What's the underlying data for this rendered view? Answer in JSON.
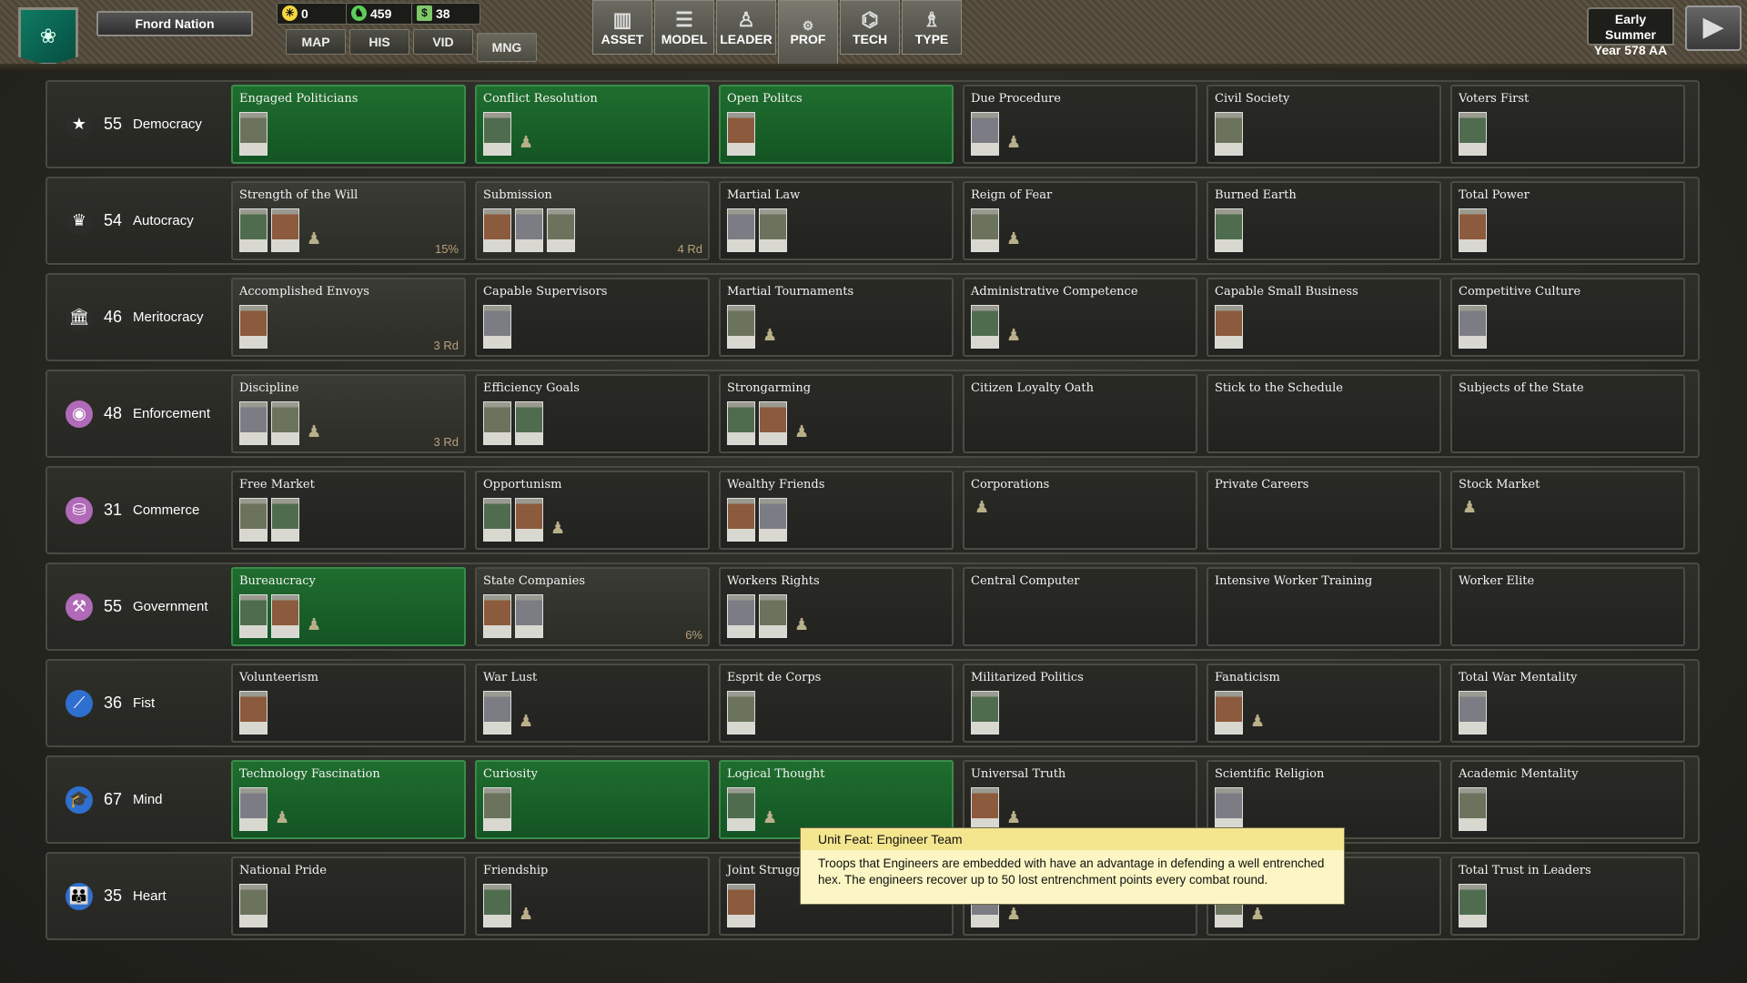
{
  "header": {
    "nation": "Fnord Nation",
    "resources": [
      {
        "icon": "sun-icon",
        "value": "0",
        "color": "#f5d63c"
      },
      {
        "icon": "shield-icon",
        "value": "459",
        "color": "#5ccf5a"
      },
      {
        "icon": "money-icon",
        "value": "38",
        "color": "#7ec86a"
      }
    ],
    "nav_tabs": [
      "MAP",
      "HIS",
      "VID",
      "MNG"
    ],
    "active_nav": "MNG",
    "modes": [
      {
        "label": "ASSET",
        "icon": "building-icon"
      },
      {
        "label": "MODEL",
        "icon": "sliders-icon"
      },
      {
        "label": "LEADER",
        "icon": "leader-icon"
      },
      {
        "label": "PROF",
        "icon": "gears-icon"
      },
      {
        "label": "TECH",
        "icon": "tech-tree-icon"
      },
      {
        "label": "TYPE",
        "icon": "soldier-icon"
      }
    ],
    "active_mode": "PROF",
    "season": "Early Summer",
    "year": "Year 578 AA"
  },
  "rows": [
    {
      "score": "55",
      "name": "Democracy",
      "icon": "star-icon",
      "icon_color": "#2c2c28",
      "cards": [
        {
          "title": "Engaged Politicians",
          "state": "done",
          "units": 1,
          "fig": false,
          "status": ""
        },
        {
          "title": "Conflict Resolution",
          "state": "done",
          "units": 1,
          "fig": true,
          "status": ""
        },
        {
          "title": "Open Politcs",
          "state": "done",
          "units": 1,
          "fig": false,
          "status": ""
        },
        {
          "title": "Due Procedure",
          "state": "locked",
          "units": 1,
          "fig": true,
          "status": ""
        },
        {
          "title": "Civil Society",
          "state": "locked",
          "units": 1,
          "fig": false,
          "status": ""
        },
        {
          "title": "Voters First",
          "state": "locked",
          "units": 1,
          "fig": false,
          "status": ""
        }
      ]
    },
    {
      "score": "54",
      "name": "Autocracy",
      "icon": "crown-icon",
      "icon_color": "#2c2c28",
      "cards": [
        {
          "title": "Strength of the Will",
          "state": "prog",
          "units": 2,
          "fig": true,
          "status": "15%"
        },
        {
          "title": "Submission",
          "state": "prog",
          "units": 3,
          "fig": false,
          "status": "4 Rd"
        },
        {
          "title": "Martial Law",
          "state": "locked",
          "units": 2,
          "fig": false,
          "status": ""
        },
        {
          "title": "Reign of Fear",
          "state": "locked",
          "units": 1,
          "fig": true,
          "status": ""
        },
        {
          "title": "Burned Earth",
          "state": "locked",
          "units": 1,
          "fig": false,
          "status": ""
        },
        {
          "title": "Total Power",
          "state": "locked",
          "units": 1,
          "fig": false,
          "status": ""
        }
      ]
    },
    {
      "score": "46",
      "name": "Meritocracy",
      "icon": "columns-icon",
      "icon_color": "#2c2c28",
      "cards": [
        {
          "title": "Accomplished Envoys",
          "state": "prog",
          "units": 1,
          "fig": false,
          "status": "3 Rd"
        },
        {
          "title": "Capable Supervisors",
          "state": "locked",
          "units": 1,
          "fig": false,
          "status": ""
        },
        {
          "title": "Martial Tournaments",
          "state": "locked",
          "units": 1,
          "fig": true,
          "status": ""
        },
        {
          "title": "Administrative Competence",
          "state": "locked",
          "units": 1,
          "fig": true,
          "status": ""
        },
        {
          "title": "Capable Small Business",
          "state": "locked",
          "units": 1,
          "fig": false,
          "status": ""
        },
        {
          "title": "Competitive Culture",
          "state": "locked",
          "units": 1,
          "fig": false,
          "status": ""
        }
      ]
    },
    {
      "score": "48",
      "name": "Enforcement",
      "icon": "eye-icon",
      "icon_color": "#b06ab8",
      "cards": [
        {
          "title": "Discipline",
          "state": "prog",
          "units": 2,
          "fig": true,
          "status": "3 Rd"
        },
        {
          "title": "Efficiency Goals",
          "state": "locked",
          "units": 2,
          "fig": false,
          "status": ""
        },
        {
          "title": "Strongarming",
          "state": "locked",
          "units": 2,
          "fig": true,
          "status": ""
        },
        {
          "title": "Citizen Loyalty Oath",
          "state": "locked",
          "units": 0,
          "fig": false,
          "status": ""
        },
        {
          "title": "Stick to the Schedule",
          "state": "locked",
          "units": 0,
          "fig": false,
          "status": ""
        },
        {
          "title": "Subjects of the State",
          "state": "locked",
          "units": 0,
          "fig": false,
          "status": ""
        }
      ]
    },
    {
      "score": "31",
      "name": "Commerce",
      "icon": "coins-icon",
      "icon_color": "#b06ab8",
      "cards": [
        {
          "title": "Free Market",
          "state": "locked",
          "units": 2,
          "fig": false,
          "status": ""
        },
        {
          "title": "Opportunism",
          "state": "locked",
          "units": 2,
          "fig": true,
          "status": ""
        },
        {
          "title": "Wealthy Friends",
          "state": "locked",
          "units": 2,
          "fig": false,
          "status": ""
        },
        {
          "title": "Corporations",
          "state": "locked",
          "units": 0,
          "fig": true,
          "status": ""
        },
        {
          "title": "Private Careers",
          "state": "locked",
          "units": 0,
          "fig": false,
          "status": ""
        },
        {
          "title": "Stock Market",
          "state": "locked",
          "units": 0,
          "fig": true,
          "status": ""
        }
      ]
    },
    {
      "score": "55",
      "name": "Government",
      "icon": "hammer-sickle-icon",
      "icon_color": "#b06ab8",
      "cards": [
        {
          "title": "Bureaucracy",
          "state": "done",
          "units": 2,
          "fig": true,
          "status": ""
        },
        {
          "title": "State Companies",
          "state": "prog",
          "units": 2,
          "fig": false,
          "status": "6%"
        },
        {
          "title": "Workers Rights",
          "state": "locked",
          "units": 2,
          "fig": true,
          "status": ""
        },
        {
          "title": "Central Computer",
          "state": "locked",
          "units": 0,
          "fig": false,
          "status": ""
        },
        {
          "title": "Intensive Worker Training",
          "state": "locked",
          "units": 0,
          "fig": false,
          "status": ""
        },
        {
          "title": "Worker Elite",
          "state": "locked",
          "units": 0,
          "fig": false,
          "status": ""
        }
      ]
    },
    {
      "score": "36",
      "name": "Fist",
      "icon": "sword-icon",
      "icon_color": "#2f6fd0",
      "cards": [
        {
          "title": "Volunteerism",
          "state": "locked",
          "units": 1,
          "fig": false,
          "status": ""
        },
        {
          "title": "War Lust",
          "state": "locked",
          "units": 1,
          "fig": true,
          "status": ""
        },
        {
          "title": "Esprit de Corps",
          "state": "locked",
          "units": 1,
          "fig": false,
          "status": ""
        },
        {
          "title": "Militarized Politics",
          "state": "locked",
          "units": 1,
          "fig": false,
          "status": ""
        },
        {
          "title": "Fanaticism",
          "state": "locked",
          "units": 1,
          "fig": true,
          "status": ""
        },
        {
          "title": "Total War Mentality",
          "state": "locked",
          "units": 1,
          "fig": false,
          "status": ""
        }
      ]
    },
    {
      "score": "67",
      "name": "Mind",
      "icon": "graduation-cap-icon",
      "icon_color": "#2f6fd0",
      "cards": [
        {
          "title": "Technology Fascination",
          "state": "done",
          "units": 1,
          "fig": true,
          "status": ""
        },
        {
          "title": "Curiosity",
          "state": "done",
          "units": 1,
          "fig": false,
          "status": ""
        },
        {
          "title": "Logical Thought",
          "state": "done",
          "units": 1,
          "fig": true,
          "status": ""
        },
        {
          "title": "Universal Truth",
          "state": "locked",
          "units": 1,
          "fig": true,
          "status": ""
        },
        {
          "title": "Scientific Religion",
          "state": "locked",
          "units": 1,
          "fig": false,
          "status": ""
        },
        {
          "title": "Academic Mentality",
          "state": "locked",
          "units": 1,
          "fig": false,
          "status": ""
        }
      ]
    },
    {
      "score": "35",
      "name": "Heart",
      "icon": "family-icon",
      "icon_color": "#2f6fd0",
      "cards": [
        {
          "title": "National Pride",
          "state": "locked",
          "units": 1,
          "fig": false,
          "status": ""
        },
        {
          "title": "Friendship",
          "state": "locked",
          "units": 1,
          "fig": true,
          "status": ""
        },
        {
          "title": "Joint Struggle",
          "state": "locked",
          "units": 1,
          "fig": false,
          "status": ""
        },
        {
          "title": "",
          "state": "locked",
          "units": 1,
          "fig": true,
          "status": ""
        },
        {
          "title": "",
          "state": "locked",
          "units": 1,
          "fig": true,
          "status": ""
        },
        {
          "title": "Total Trust in Leaders",
          "state": "locked",
          "units": 1,
          "fig": false,
          "status": ""
        }
      ]
    }
  ],
  "tooltip": {
    "title": "Unit Feat: Engineer Team",
    "body": "Troops that Engineers are embedded with have an advantage in defending a well entrenched hex. The engineers recover up to 50 lost entrenchment points every combat round."
  }
}
